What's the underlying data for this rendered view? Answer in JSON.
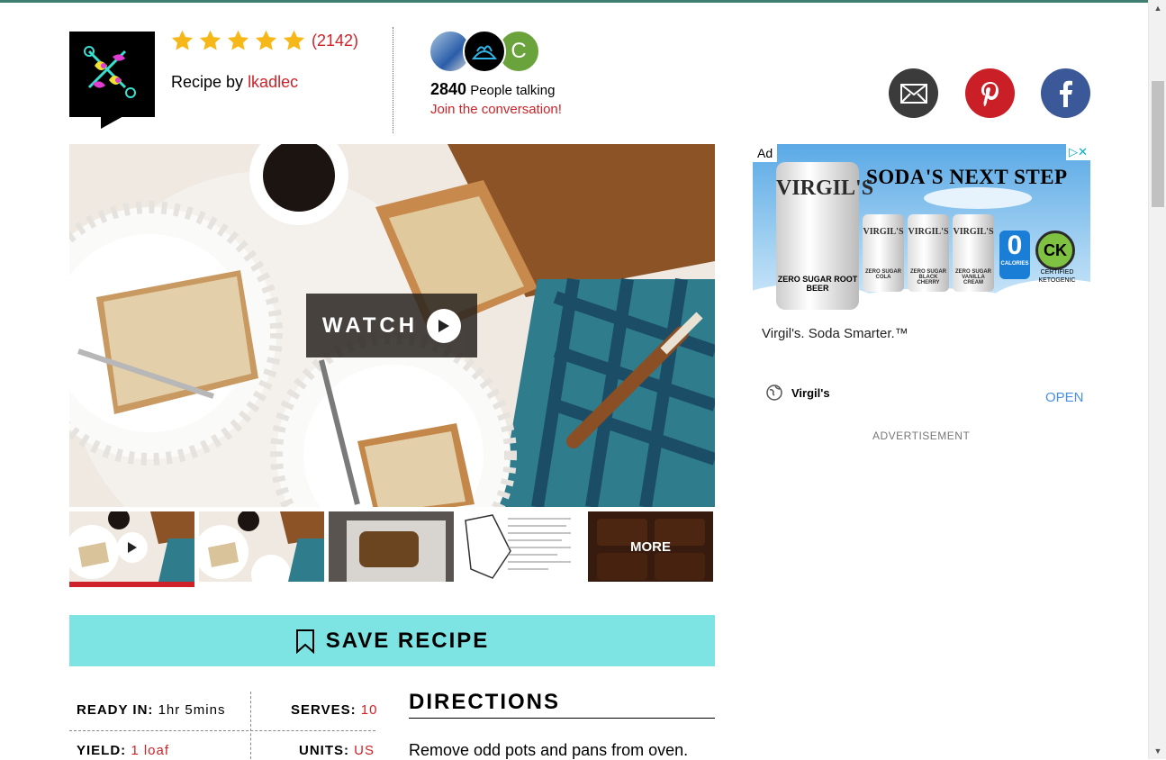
{
  "colors": {
    "accent_red": "#ce2228",
    "save_teal": "#7de3e3",
    "topbar": "#3f7f72"
  },
  "rating": {
    "stars": 5,
    "count": "(2142)"
  },
  "author": {
    "label": "Recipe by",
    "name": "lkadlec"
  },
  "talk": {
    "count": "2840",
    "label": " People talking",
    "join": "Join the conversation!",
    "avatar3_initial": "C"
  },
  "share": {
    "email": "email-icon",
    "pinterest": "pinterest-icon",
    "facebook": "facebook-icon"
  },
  "video": {
    "watch_label": "WATCH"
  },
  "thumbs": {
    "more_label": "MORE"
  },
  "save": {
    "label": "SAVE RECIPE"
  },
  "info": {
    "ready_in_key": "READY IN:",
    "ready_in_val": "1hr 5mins",
    "serves_key": "SERVES:",
    "serves_val": "10",
    "yield_key": "YIELD:",
    "yield_val": "1 loaf",
    "units_key": "UNITS:",
    "units_val": "US"
  },
  "directions": {
    "title": "DIRECTIONS",
    "step1": "Remove odd pots and pans from oven."
  },
  "ad": {
    "badge": "Ad",
    "choices": "▷✕",
    "headline": "SODA'S NEXT STEP",
    "brand": "VIRGIL'S",
    "can_label": "ZERO SUGAR ROOT BEER",
    "flavors": [
      "ZERO SUGAR COLA",
      "ZERO SUGAR BLACK CHERRY",
      "ZERO SUGAR VANILLA CREAM"
    ],
    "zero": "0",
    "calories": "CALORIES",
    "ck": "CK",
    "ck_text": "CERTIFIED KETOGENIC",
    "caption": "Virgil's. Soda Smarter.™",
    "advertiser": "Virgil's",
    "open": "OPEN",
    "label": "ADVERTISEMENT"
  }
}
